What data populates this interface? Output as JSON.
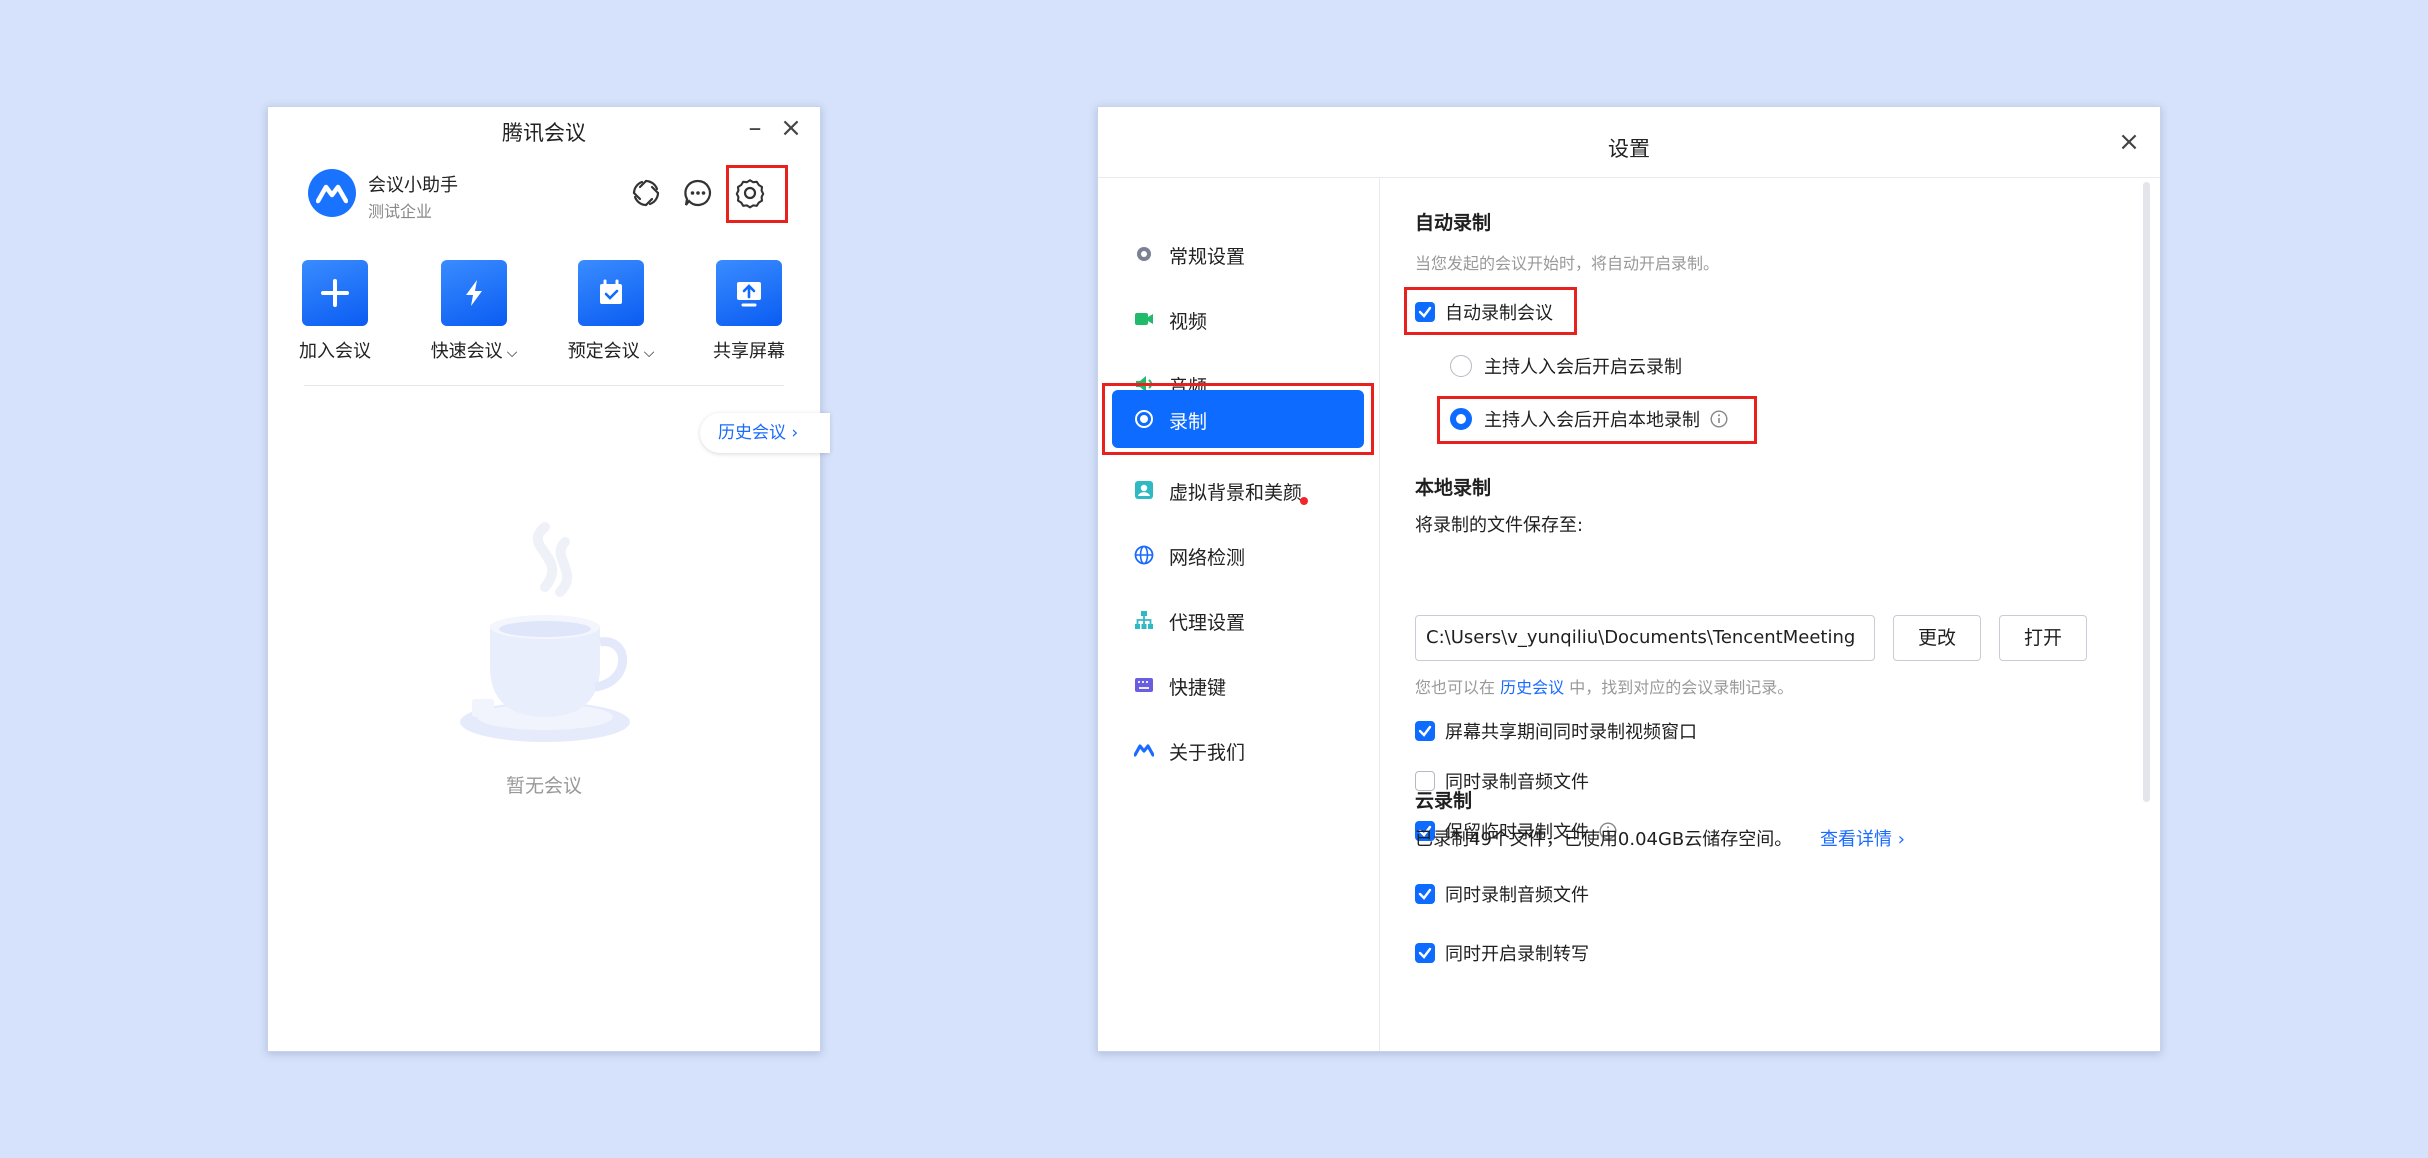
{
  "main_window": {
    "title": "腾讯会议",
    "user": {
      "name": "会议小助手",
      "company": "测试企业"
    },
    "actions": [
      {
        "label": "加入会议",
        "icon": "plus-icon",
        "has_dropdown": false
      },
      {
        "label": "快速会议",
        "icon": "lightning-icon",
        "has_dropdown": true
      },
      {
        "label": "预定会议",
        "icon": "calendar-icon",
        "has_dropdown": true
      },
      {
        "label": "共享屏幕",
        "icon": "share-screen-icon",
        "has_dropdown": false
      }
    ],
    "history_button": "历史会议",
    "empty_text": "暂无会议"
  },
  "settings": {
    "title": "设置",
    "nav": [
      {
        "label": "常规设置",
        "icon": "gear-icon"
      },
      {
        "label": "视频",
        "icon": "camera-icon"
      },
      {
        "label": "音频",
        "icon": "speaker-icon"
      },
      {
        "label": "录制",
        "icon": "record-icon",
        "active": true
      },
      {
        "label": "虚拟背景和美颜",
        "icon": "portrait-icon"
      },
      {
        "label": "网络检测",
        "icon": "globe-icon"
      },
      {
        "label": "代理设置",
        "icon": "network-icon"
      },
      {
        "label": "快捷键",
        "icon": "keyboard-icon"
      },
      {
        "label": "关于我们",
        "icon": "logo-icon"
      }
    ],
    "auto_record": {
      "title": "自动录制",
      "hint": "当您发起的会议开始时，将自动开启录制。",
      "checkbox_label": "自动录制会议",
      "checked": true,
      "options": [
        {
          "label": "主持人入会后开启云录制",
          "selected": false
        },
        {
          "label": "主持人入会后开启本地录制",
          "selected": true
        }
      ]
    },
    "local_record": {
      "title": "本地录制",
      "save_label": "将录制的文件保存至:",
      "path": "C:\\Users\\v_yunqiliu\\Documents\\TencentMeeting",
      "change_button": "更改",
      "open_button": "打开",
      "hint_prefix": "您也可以在",
      "hint_link": "历史会议",
      "hint_suffix": "中，找到对应的会议录制记录。",
      "options": [
        {
          "label": "屏幕共享期间同时录制视频窗口",
          "checked": true
        },
        {
          "label": "同时录制音频文件",
          "checked": false
        },
        {
          "label": "保留临时录制文件",
          "checked": true
        }
      ]
    },
    "cloud_record": {
      "title": "云录制",
      "usage": "已录制49个文件，已使用0.04GB云储存空间。",
      "details_link": "查看详情",
      "options": [
        {
          "label": "同时录制音频文件",
          "checked": true
        },
        {
          "label": "同时开启录制转写",
          "checked": true
        }
      ]
    }
  },
  "colors": {
    "accent": "#0d6bff",
    "highlight": "#e8211f",
    "background": "#d6e2fb"
  }
}
